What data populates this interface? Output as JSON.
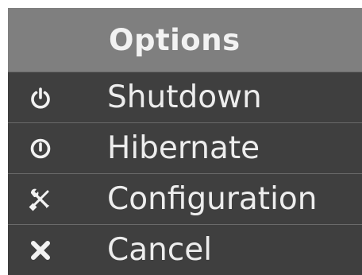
{
  "menu": {
    "title": "Options",
    "items": [
      {
        "label": "Shutdown",
        "icon": "power-icon"
      },
      {
        "label": "Hibernate",
        "icon": "hibernate-icon"
      },
      {
        "label": "Configuration",
        "icon": "tools-icon"
      },
      {
        "label": "Cancel",
        "icon": "close-icon"
      }
    ]
  },
  "colors": {
    "header_bg": "#7f7f7f",
    "menu_bg": "#3f3f3f",
    "text": "#ededed"
  }
}
